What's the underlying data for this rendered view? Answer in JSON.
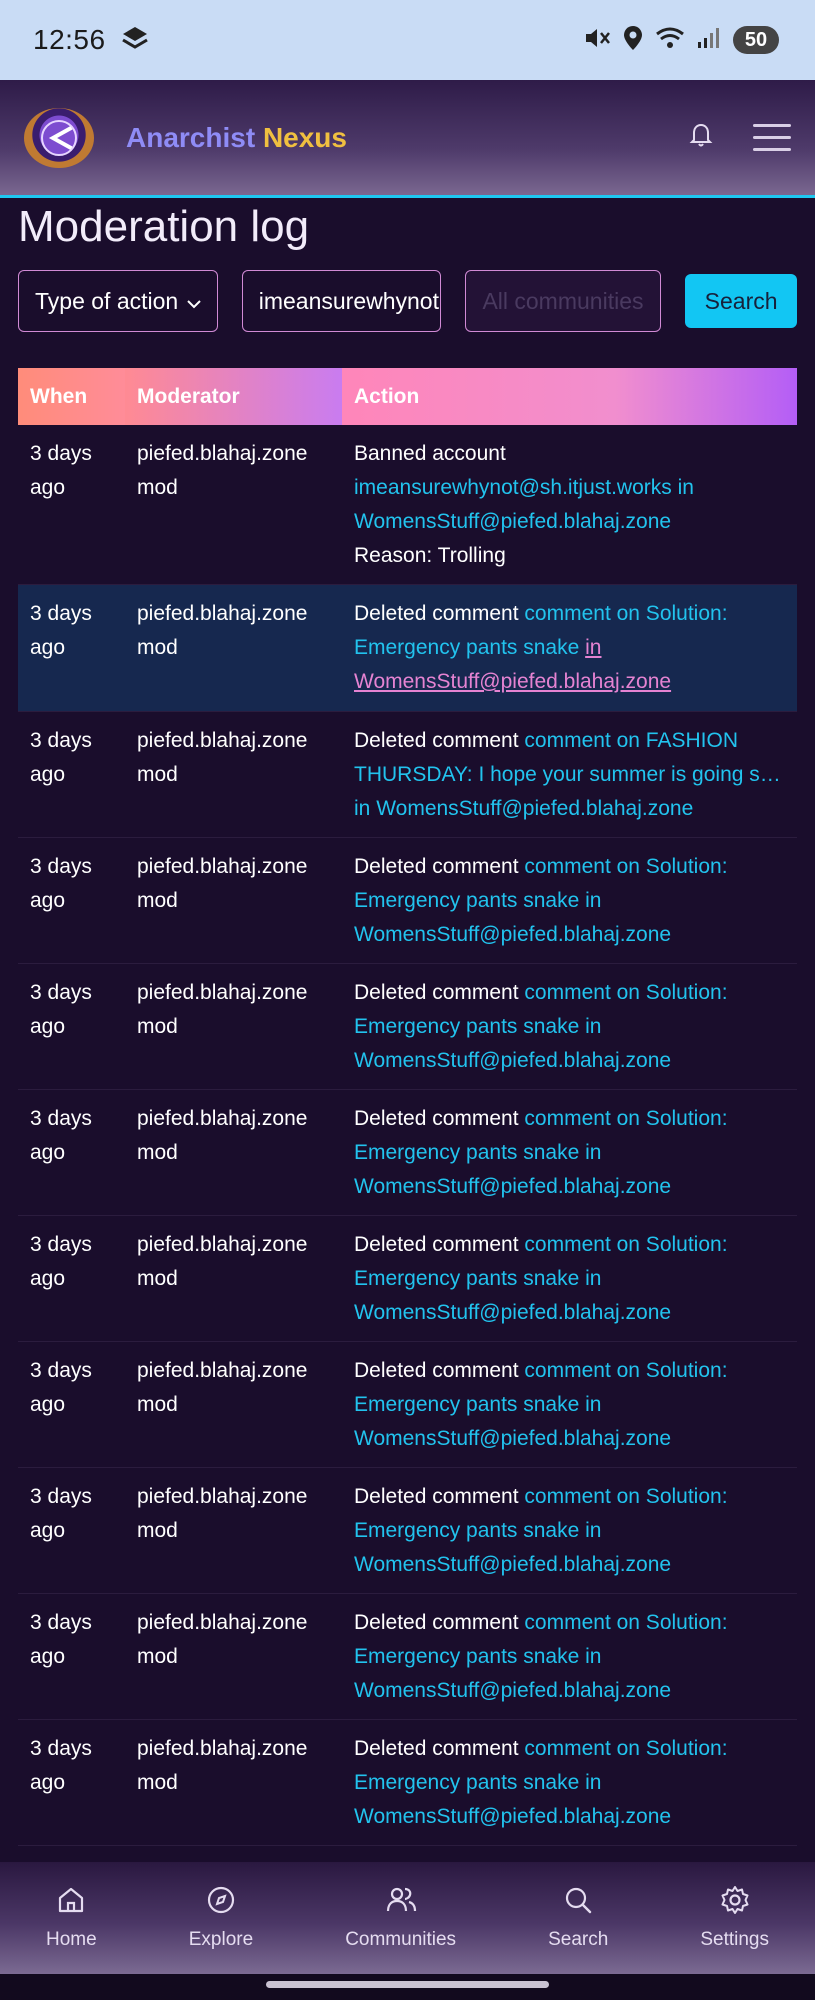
{
  "status_bar": {
    "time": "12:56",
    "battery": "50"
  },
  "header": {
    "brand_part1": "Anarchist",
    "brand_part2": "Nexus"
  },
  "page": {
    "title": "Moderation log"
  },
  "filters": {
    "type_label": "Type of action",
    "user_value": "imeansurewhynot",
    "community_placeholder": "All communities",
    "search_label": "Search"
  },
  "table": {
    "headers": {
      "when": "When",
      "moderator": "Moderator",
      "action": "Action"
    },
    "rows": [
      {
        "when": "3 days ago",
        "moderator": "piefed.blahaj.zone mod",
        "action": "Banned account",
        "link": "imeansurewhynot@sh.itjust.works",
        "in_text": "in",
        "community": "WomensStuff@piefed.blahaj.zone",
        "reason": "Reason: Trolling"
      },
      {
        "when": "3 days ago",
        "moderator": "piefed.blahaj.zone mod",
        "action": "Deleted comment",
        "link": "comment on Solution: Emergency pants snake",
        "in_text": "in",
        "community": "WomensStuff@piefed.blahaj.zone"
      },
      {
        "when": "3 days ago",
        "moderator": "piefed.blahaj.zone mod",
        "action": "Deleted comment",
        "link": "comment on FASHION THURSDAY: I hope your summer is going s…",
        "in_text": "in",
        "community": "WomensStuff@piefed.blahaj.zone"
      },
      {
        "when": "3 days ago",
        "moderator": "piefed.blahaj.zone mod",
        "action": "Deleted comment",
        "link": "comment on Solution: Emergency pants snake",
        "in_text": "in",
        "community": "WomensStuff@piefed.blahaj.zone"
      },
      {
        "when": "3 days ago",
        "moderator": "piefed.blahaj.zone mod",
        "action": "Deleted comment",
        "link": "comment on Solution: Emergency pants snake",
        "in_text": "in",
        "community": "WomensStuff@piefed.blahaj.zone"
      },
      {
        "when": "3 days ago",
        "moderator": "piefed.blahaj.zone mod",
        "action": "Deleted comment",
        "link": "comment on Solution: Emergency pants snake",
        "in_text": "in",
        "community": "WomensStuff@piefed.blahaj.zone"
      },
      {
        "when": "3 days ago",
        "moderator": "piefed.blahaj.zone mod",
        "action": "Deleted comment",
        "link": "comment on Solution: Emergency pants snake",
        "in_text": "in",
        "community": "WomensStuff@piefed.blahaj.zone"
      },
      {
        "when": "3 days ago",
        "moderator": "piefed.blahaj.zone mod",
        "action": "Deleted comment",
        "link": "comment on Solution: Emergency pants snake",
        "in_text": "in",
        "community": "WomensStuff@piefed.blahaj.zone"
      },
      {
        "when": "3 days ago",
        "moderator": "piefed.blahaj.zone mod",
        "action": "Deleted comment",
        "link": "comment on Solution: Emergency pants snake",
        "in_text": "in",
        "community": "WomensStuff@piefed.blahaj.zone"
      },
      {
        "when": "3 days ago",
        "moderator": "piefed.blahaj.zone mod",
        "action": "Deleted comment",
        "link": "comment on Solution: Emergency pants snake",
        "in_text": "in",
        "community": "WomensStuff@piefed.blahaj.zone"
      },
      {
        "when": "3 days ago",
        "moderator": "piefed.blahaj.zone mod",
        "action": "Deleted comment",
        "link": "comment on Solution: Emergency pants snake",
        "in_text": "in",
        "community": "WomensStuff@piefed.blahaj.zone"
      }
    ]
  },
  "bottom_nav": [
    {
      "label": "Home",
      "icon": "home-icon"
    },
    {
      "label": "Explore",
      "icon": "compass-icon"
    },
    {
      "label": "Communities",
      "icon": "people-icon"
    },
    {
      "label": "Search",
      "icon": "search-icon"
    },
    {
      "label": "Settings",
      "icon": "gear-icon"
    }
  ],
  "colors": {
    "accent": "#12c6f3",
    "link": "#22c3ee",
    "background": "#1a0d2c"
  }
}
